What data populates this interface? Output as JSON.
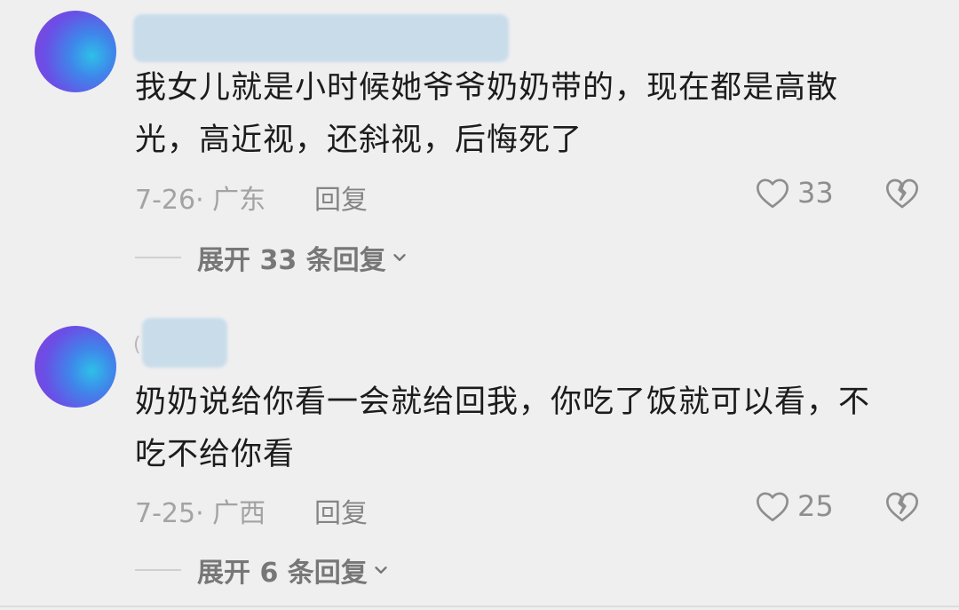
{
  "comments": [
    {
      "text_line1": "我女儿就是小时候她爷爷奶奶带的，现在都是高散",
      "text_line2": "光，高近视，还斜视，后悔死了",
      "meta": "7-26· 广东",
      "reply_label": "回复",
      "likes": "33",
      "expand_label": "展开 33 条回复"
    },
    {
      "name_char": "(",
      "text_line1": "奶奶说给你看一会就给回我，你吃了饭就可以看，不",
      "text_line2": "吃不给你看",
      "meta": "7-25· 广西",
      "reply_label": "回复",
      "likes": "25",
      "expand_label": "展开 6 条回复"
    }
  ],
  "icons": {
    "like": "heart-outline-icon",
    "dislike": "broken-heart-icon",
    "expand": "chevron-down-icon"
  },
  "colors": {
    "background": "#efeff0",
    "text": "#1c1c1c",
    "meta": "#a3a3a3",
    "name_blur": "#c9dcea"
  }
}
